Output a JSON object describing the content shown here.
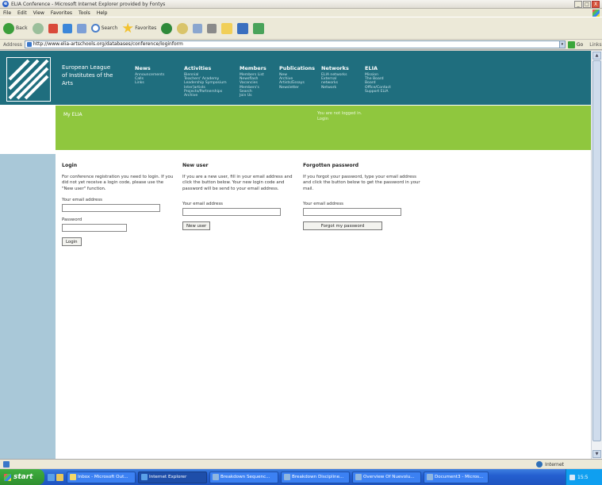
{
  "window": {
    "title": "ELIA Conference - Microsoft Internet Explorer provided by Fontys",
    "buttons": [
      "_",
      "□",
      "X"
    ]
  },
  "menu": [
    "File",
    "Edit",
    "View",
    "Favorites",
    "Tools",
    "Help"
  ],
  "toolbar": {
    "back_label": "Back",
    "search_label": "Search",
    "favorites_label": "Favorites"
  },
  "address": {
    "label": "Address",
    "url": "http://www.elia-artschools.org/databases/conference/loginform",
    "go_label": "Go",
    "links_label": "Links"
  },
  "header": {
    "org_name": "European League of Institutes of the Arts",
    "nav": [
      {
        "head": "News",
        "items": [
          "Announcements",
          "Calls",
          "Links"
        ]
      },
      {
        "head": "Activities",
        "items": [
          "Biennial",
          "Teachers' Academy",
          "Leadership Symposium",
          "Inter]artists",
          "Projects/Partnerships",
          "Archive"
        ]
      },
      {
        "head": "Members",
        "items": [
          "Members List",
          "Newsflash",
          "Vacancies",
          "Members's",
          "Search",
          "Join Us"
        ]
      },
      {
        "head": "Publications",
        "items": [
          "New",
          "Archive",
          "Artists/Essays",
          "Newsletter"
        ]
      },
      {
        "head": "Networks",
        "items": [
          "ELIA networks",
          "External",
          "networks",
          "Network"
        ]
      },
      {
        "head": "ELIA",
        "items": [
          "Mission",
          "The Board",
          "Board",
          "Office/Contact",
          "Support ELIA"
        ]
      }
    ]
  },
  "banner": {
    "title": "My ELIA",
    "status_line1": "You are not logged in.",
    "status_line2": "Login"
  },
  "login": {
    "heading": "Login",
    "text": "For conference registration you need to login. If you did not yet receive a login code, please use the \"New user\" function.",
    "email_label": "Your email address",
    "password_label": "Password",
    "button": "Login"
  },
  "new_user": {
    "heading": "New user",
    "text": "If you are a new user, fill in your email address and click the button below. Your new login code and password will be send to your email address.",
    "email_label": "Your email address",
    "button": "New user"
  },
  "forgotten": {
    "heading": "Forgotten password",
    "text": "If you forgot your password, type your email address and click the button below to get the password in your mail.",
    "email_label": "Your email address",
    "button": "Forgot my password"
  },
  "status": {
    "zone": "Internet"
  },
  "taskbar": {
    "start": "start",
    "tasks": [
      "Inbox - Microsoft Out...",
      "Internet Explorer",
      "Breakdown Sequenc...",
      "Breakdown Discipline...",
      "Overview Of Nuevolu...",
      "Document3 - Micros..."
    ],
    "clock": "15:5"
  }
}
